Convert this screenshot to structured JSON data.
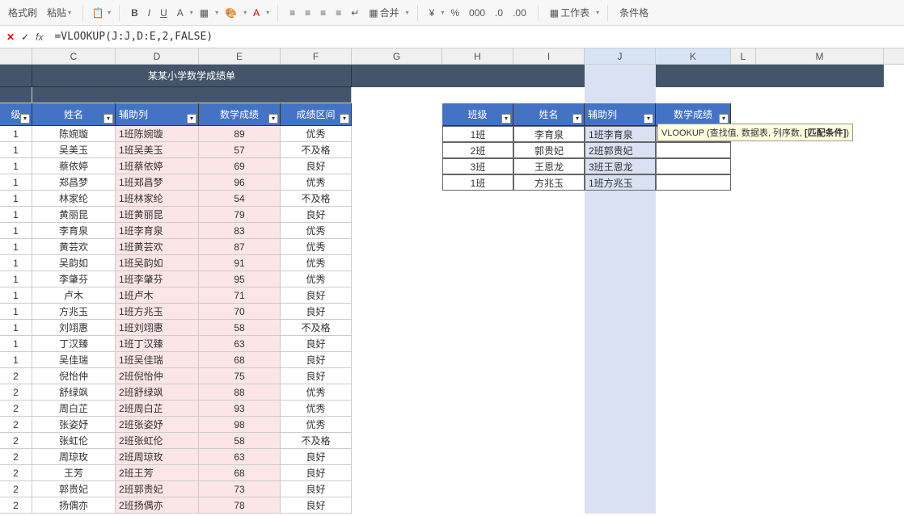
{
  "toolbar": {
    "format_brush": "格式刷",
    "paste": "粘贴",
    "bold": "B",
    "italic": "I",
    "underline": "U",
    "A": "A",
    "merge": "合并",
    "worksheet": "工作表",
    "conditional": "条件格"
  },
  "formula_bar": {
    "cancel": "✕",
    "confirm": "✓",
    "fx": "fx",
    "formula": "=VLOOKUP(J:J,D:E,2,FALSE)"
  },
  "columns": [
    "",
    "C",
    "D",
    "E",
    "F",
    "G",
    "H",
    "I",
    "J",
    "K",
    "L",
    "M"
  ],
  "title": "某某小学数学成绩单",
  "left_headers": {
    "b": "级",
    "c": "姓名",
    "d": "辅助列",
    "e": "数学成绩",
    "f": "成绩区间"
  },
  "right_headers": {
    "h": "班级",
    "i": "姓名",
    "j": "辅助列",
    "k": "数学成绩"
  },
  "left_rows": [
    {
      "b": "1",
      "c": "陈婉璇",
      "d": "1班陈婉璇",
      "e": "89",
      "f": "优秀"
    },
    {
      "b": "1",
      "c": "吴美玉",
      "d": "1班吴美玉",
      "e": "57",
      "f": "不及格"
    },
    {
      "b": "1",
      "c": "蔡依婷",
      "d": "1班蔡依婷",
      "e": "69",
      "f": "良好"
    },
    {
      "b": "1",
      "c": "郑昌梦",
      "d": "1班郑昌梦",
      "e": "96",
      "f": "优秀"
    },
    {
      "b": "1",
      "c": "林家纶",
      "d": "1班林家纶",
      "e": "54",
      "f": "不及格"
    },
    {
      "b": "1",
      "c": "黄丽昆",
      "d": "1班黄丽昆",
      "e": "79",
      "f": "良好"
    },
    {
      "b": "1",
      "c": "李育泉",
      "d": "1班李育泉",
      "e": "83",
      "f": "优秀"
    },
    {
      "b": "1",
      "c": "黄芸欢",
      "d": "1班黄芸欢",
      "e": "87",
      "f": "优秀"
    },
    {
      "b": "1",
      "c": "吴韵如",
      "d": "1班吴韵如",
      "e": "91",
      "f": "优秀"
    },
    {
      "b": "1",
      "c": "李肇芬",
      "d": "1班李肇芬",
      "e": "95",
      "f": "优秀"
    },
    {
      "b": "1",
      "c": "卢木",
      "d": "1班卢木",
      "e": "71",
      "f": "良好"
    },
    {
      "b": "1",
      "c": "方兆玉",
      "d": "1班方兆玉",
      "e": "70",
      "f": "良好"
    },
    {
      "b": "1",
      "c": "刘翊惠",
      "d": "1班刘翊惠",
      "e": "58",
      "f": "不及格"
    },
    {
      "b": "1",
      "c": "丁汉臻",
      "d": "1班丁汉臻",
      "e": "63",
      "f": "良好"
    },
    {
      "b": "1",
      "c": "吴佳瑞",
      "d": "1班吴佳瑞",
      "e": "68",
      "f": "良好"
    },
    {
      "b": "2",
      "c": "倪怡仲",
      "d": "2班倪怡仲",
      "e": "75",
      "f": "良好"
    },
    {
      "b": "2",
      "c": "舒绿飒",
      "d": "2班舒绿飒",
      "e": "88",
      "f": "优秀"
    },
    {
      "b": "2",
      "c": "周白芷",
      "d": "2班周白芷",
      "e": "93",
      "f": "优秀"
    },
    {
      "b": "2",
      "c": "张姿妤",
      "d": "2班张姿妤",
      "e": "98",
      "f": "优秀"
    },
    {
      "b": "2",
      "c": "张虹伦",
      "d": "2班张虹伦",
      "e": "58",
      "f": "不及格"
    },
    {
      "b": "2",
      "c": "周琼玫",
      "d": "2班周琼玫",
      "e": "63",
      "f": "良好"
    },
    {
      "b": "2",
      "c": "王芳",
      "d": "2班王芳",
      "e": "68",
      "f": "良好"
    },
    {
      "b": "2",
      "c": "郭贵妃",
      "d": "2班郭贵妃",
      "e": "73",
      "f": "良好"
    },
    {
      "b": "2",
      "c": "扬偶亦",
      "d": "2班扬偶亦",
      "e": "78",
      "f": "良好"
    }
  ],
  "right_rows": [
    {
      "h": "1班",
      "i": "李育泉",
      "j": "1班李育泉",
      "k_formula": true
    },
    {
      "h": "2班",
      "i": "郭贵妃",
      "j": "2班郭贵妃"
    },
    {
      "h": "3班",
      "i": "王恩龙",
      "j": "3班王恩龙"
    },
    {
      "h": "1班",
      "i": "方兆玉",
      "j": "1班方兆玉"
    }
  ],
  "active_formula": {
    "prefix": "=",
    "func": "VLOOKUP",
    "open": "(",
    "arg1": "J:J",
    "c1": ",",
    "arg2": "D:E",
    "c2": ",2,FALSE)",
    "full": "=VLOOKUP(J:J,D:E,2,FALSE)"
  },
  "tooltip": "VLOOKUP (查找值, 数据表, 列序数, [匹配条件])"
}
